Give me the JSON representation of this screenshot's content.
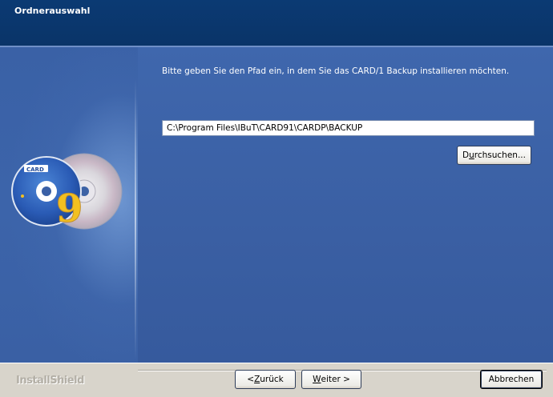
{
  "header": {
    "title": "Ordnerauswahl"
  },
  "main": {
    "prompt": "Bitte geben Sie den Pfad ein, in dem Sie das CARD/1 Backup installieren möchten.",
    "path_value": "C:\\Program Files\\IBuT\\CARD91\\CARDP\\BACKUP",
    "browse_label_pre": "D",
    "browse_label_u": "u",
    "browse_label_post": "rchsuchen..."
  },
  "logo": {
    "cd_label": "CARD",
    "cd_number": "9"
  },
  "footer": {
    "brand": "InstallShield",
    "back_pre": "< ",
    "back_u": "Z",
    "back_post": "urück",
    "next_u": "W",
    "next_post": "eiter >",
    "cancel_label": "Abbrechen"
  },
  "colors": {
    "header_bg": "#0b3a73",
    "panel_bg": "#3c62a6",
    "footer_bg": "#d8d4cb"
  }
}
